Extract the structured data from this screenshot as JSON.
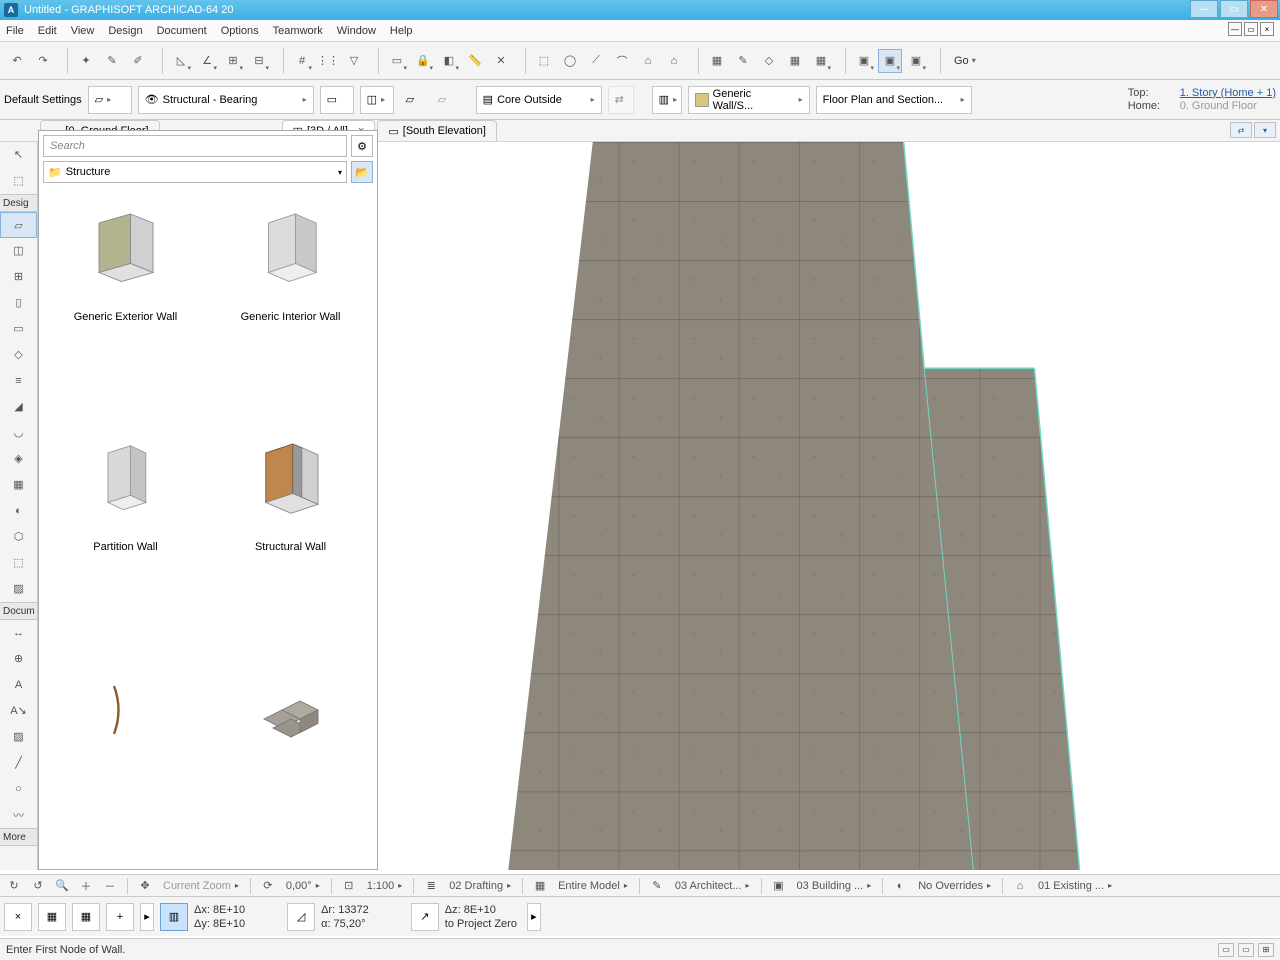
{
  "title": "Untitled - GRAPHISOFT ARCHICAD-64 20",
  "menu": [
    "File",
    "Edit",
    "View",
    "Design",
    "Document",
    "Options",
    "Teamwork",
    "Window",
    "Help"
  ],
  "toolbar1": {
    "go_label": "Go"
  },
  "infobox": {
    "default_settings": "Default Settings",
    "structural": "Structural - Bearing",
    "core_outside": "Core Outside",
    "generic_wall": "Generic Wall/S...",
    "floor_plan": "Floor Plan and Section...",
    "top_label": "Top:",
    "top_value": "1. Story (Home + 1)",
    "home_label": "Home:",
    "home_value": "0. Ground Floor"
  },
  "tabs": {
    "ground": "[0. Ground Floor]",
    "threed": "[3D / All]",
    "south": "[South Elevation]"
  },
  "toolbox": {
    "design_label": "Desig",
    "document_label": "Docum",
    "more_label": "More"
  },
  "favorites": {
    "search_placeholder": "Search",
    "folder_label": "Structure",
    "items": [
      "Generic Exterior Wall",
      "Generic Interior Wall",
      "Partition Wall",
      "Structural Wall"
    ]
  },
  "quickbar": {
    "current_zoom": "Current Zoom",
    "deg": "0,00°",
    "scale": "1:100",
    "drafting": "02 Drafting",
    "entire_model": "Entire Model",
    "architect": "03 Architect...",
    "building": "03 Building ...",
    "overrides": "No Overrides",
    "existing": "01 Existing ..."
  },
  "coords": {
    "dx": "Δx: 8E+10",
    "dy": "Δy: 8E+10",
    "dr": "Δr: 13372",
    "da": "α: 75,20°",
    "dz": "Δz: 8E+10",
    "to_zero": "to Project Zero"
  },
  "statusbar": {
    "hint": "Enter First Node of Wall."
  }
}
